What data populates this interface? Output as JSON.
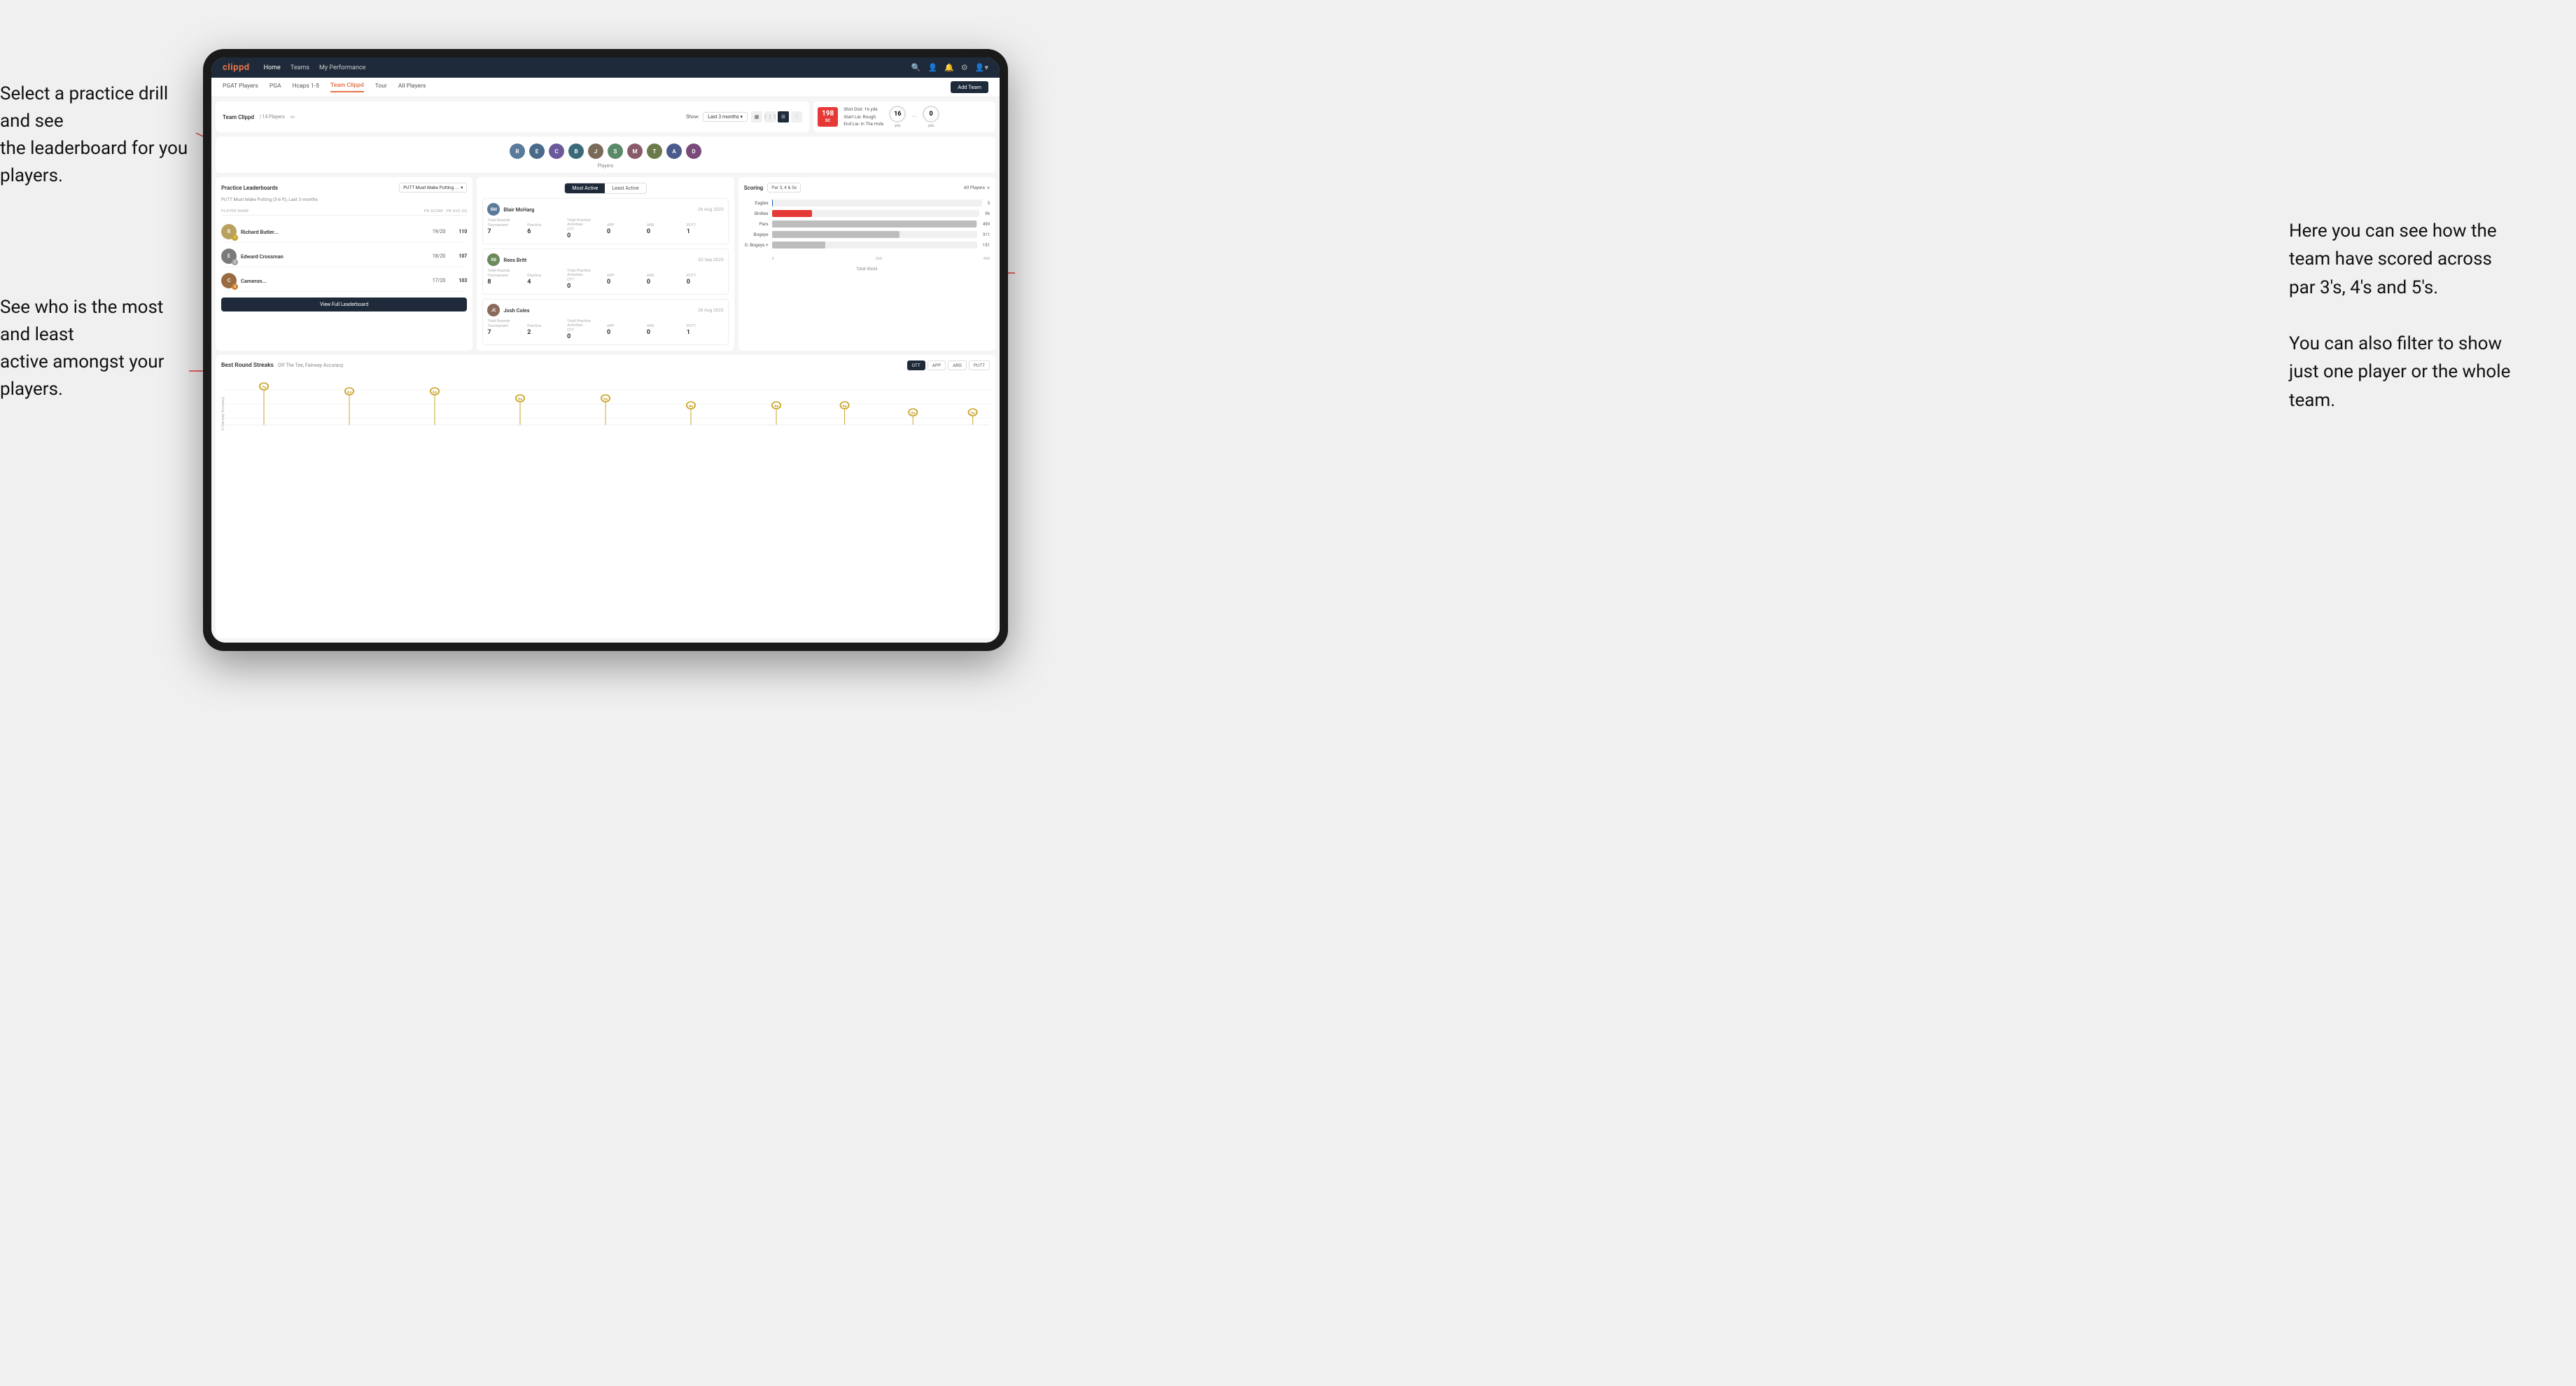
{
  "annotations": {
    "top_left": "Select a practice drill and see\nthe leaderboard for you players.",
    "bottom_left": "See who is the most and least\nactive amongst your players.",
    "right": "Here you can see how the\nteam have scored across\npar 3's, 4's and 5's.\n\nYou can also filter to show\njust one player or the whole\nteam."
  },
  "nav": {
    "logo": "clippd",
    "links": [
      "Home",
      "Teams",
      "My Performance"
    ],
    "icons": [
      "search",
      "person",
      "bell",
      "settings",
      "avatar"
    ]
  },
  "sub_nav": {
    "links": [
      "PGAT Players",
      "PGA",
      "Hcaps 1-5",
      "Team Clippd",
      "Tour",
      "All Players"
    ],
    "active": "Team Clippd",
    "add_team_label": "Add Team"
  },
  "team_header": {
    "title": "Team Clippd",
    "count": "14 Players",
    "show_label": "Show:",
    "show_value": "Last 3 months",
    "views": [
      "grid-2",
      "grid-3",
      "list",
      "filter"
    ]
  },
  "players": {
    "label": "Players",
    "avatars": [
      "R",
      "E",
      "C",
      "B",
      "J",
      "S",
      "M",
      "T",
      "A",
      "D"
    ]
  },
  "score_card": {
    "score": "198",
    "score_sub": "SC",
    "info_line1": "Shot Dist: 16 yds",
    "info_line2": "Start Lie: Rough",
    "info_line3": "End Lie: In The Hole",
    "circle1_value": "16",
    "circle1_label": "yds",
    "circle2_value": "0",
    "circle2_label": "yds"
  },
  "leaderboard": {
    "title": "Practice Leaderboards",
    "dropdown_label": "PUTT Must Make Putting ...",
    "drill_name": "PUTT Must Make Putting (3-6 ft),",
    "drill_period": "Last 3 months",
    "headers": [
      "PLAYER NAME",
      "PB SCORE",
      "PB AVG SQ"
    ],
    "players": [
      {
        "name": "Richard Butler...",
        "score": "19/20",
        "avg": "110",
        "rank": 1,
        "medal": "gold"
      },
      {
        "name": "Edward Crossman",
        "score": "18/20",
        "avg": "107",
        "rank": 2,
        "medal": "silver"
      },
      {
        "name": "Cameron...",
        "score": "17/20",
        "avg": "103",
        "rank": 3,
        "medal": "bronze"
      }
    ],
    "view_leaderboard": "View Full Leaderboard"
  },
  "most_active": {
    "toggle_options": [
      "Most Active",
      "Least Active"
    ],
    "active_toggle": "Most Active",
    "players": [
      {
        "name": "Blair McHarg",
        "date": "26 Aug 2023",
        "avatar_initials": "BM",
        "total_rounds_label": "Total Rounds",
        "tournament": "7",
        "practice": "6",
        "practice_activities_label": "Total Practice Activities",
        "ott": "0",
        "app": "0",
        "arg": "0",
        "putt": "1"
      },
      {
        "name": "Rees Britt",
        "date": "02 Sep 2023",
        "avatar_initials": "RB",
        "total_rounds_label": "Total Rounds",
        "tournament": "8",
        "practice": "4",
        "practice_activities_label": "Total Practice Activities",
        "ott": "0",
        "app": "0",
        "arg": "0",
        "putt": "0"
      },
      {
        "name": "Josh Coles",
        "date": "26 Aug 2023",
        "avatar_initials": "JC",
        "total_rounds_label": "Total Rounds",
        "tournament": "7",
        "practice": "2",
        "practice_activities_label": "Total Practice Activities",
        "ott": "0",
        "app": "0",
        "arg": "0",
        "putt": "1"
      }
    ]
  },
  "scoring": {
    "title": "Scoring",
    "filter_label": "Par 3, 4 & 5s",
    "players_label": "All Players",
    "bars": [
      {
        "label": "Eagles",
        "value": 3,
        "max": 500,
        "color": "#1565c0"
      },
      {
        "label": "Birdies",
        "value": 96,
        "max": 500,
        "color": "#e53935"
      },
      {
        "label": "Pars",
        "value": 499,
        "max": 500,
        "color": "#bdbdbd"
      },
      {
        "label": "Bogeys",
        "value": 311,
        "max": 500,
        "color": "#bdbdbd"
      },
      {
        "label": "D. Bogeys +",
        "value": 131,
        "max": 500,
        "color": "#bdbdbd"
      }
    ],
    "axis_labels": [
      "0",
      "200",
      "400"
    ],
    "axis_title": "Total Shots"
  },
  "streaks": {
    "title": "Best Round Streaks",
    "subtitle": "Off The Tee, Fairway Accuracy",
    "filters": [
      "OTT",
      "APP",
      "ARG",
      "PUTT"
    ],
    "active_filter": "OTT",
    "y_axis_label": "% Fairway Accuracy",
    "data_points": [
      {
        "x": 5,
        "y": 75,
        "label": "7x"
      },
      {
        "x": 15,
        "y": 65,
        "label": "6x"
      },
      {
        "x": 25,
        "y": 65,
        "label": "6x"
      },
      {
        "x": 35,
        "y": 55,
        "label": "5x"
      },
      {
        "x": 45,
        "y": 55,
        "label": "5x"
      },
      {
        "x": 55,
        "y": 45,
        "label": "4x"
      },
      {
        "x": 65,
        "y": 45,
        "label": "4x"
      },
      {
        "x": 75,
        "y": 45,
        "label": "4x"
      },
      {
        "x": 85,
        "y": 35,
        "label": "3x"
      },
      {
        "x": 95,
        "y": 35,
        "label": "3x"
      }
    ]
  }
}
